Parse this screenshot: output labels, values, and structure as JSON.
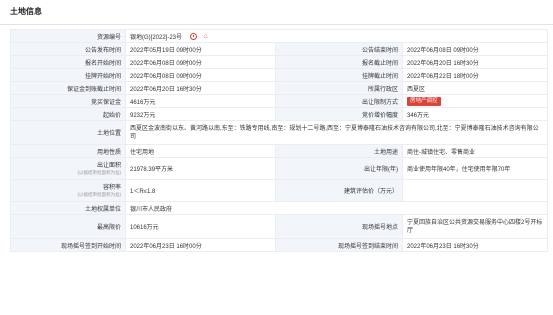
{
  "header": {
    "title": "土地信息"
  },
  "badge_color": "#d9433a",
  "rows": {
    "zybh": {
      "label": "资源编号",
      "value": "银地(G)[2022]-23号"
    },
    "ggfb": {
      "label": "公告发布时间",
      "value": "2022年05月19日 09时00分"
    },
    "ggjz": {
      "label": "公告结束时间",
      "value": "2022年06月08日 09时00分"
    },
    "bmks": {
      "label": "报名开始时间",
      "value": "2022年06月08日 09时00分"
    },
    "bmjz": {
      "label": "报名截止时间",
      "value": "2022年06月20日 16时30分"
    },
    "gpks": {
      "label": "挂牌开始时间",
      "value": "2022年06月08日 09时00分"
    },
    "gpjz": {
      "label": "挂牌截止时间",
      "value": "2022年06月22日 18时00分"
    },
    "bzj": {
      "label": "保证金到账截止时间",
      "value": "2022年06月20日 16时30分"
    },
    "xzq": {
      "label": "所属行政区",
      "value": "西夏区"
    },
    "jmbzj": {
      "label": "竞买保证金",
      "value": "4616万元"
    },
    "crxz": {
      "label": "出让限制方式",
      "value": "房地产调控"
    },
    "qsj": {
      "label": "起始价",
      "value": "9232万元"
    },
    "zjfd": {
      "label": "竞价增价幅度",
      "value": "346万元"
    },
    "tdwz": {
      "label": "土地位置",
      "value": "西夏区金波南街以东、黄河路以南,东至：铁路专用线,南至：规划十二号路,西至：宁夏博泰隆石油技术咨询有限公司,北至：宁夏博泰隆石油技术咨询有限公司"
    },
    "ydxz": {
      "label": "用地性质",
      "value": "住宅用地"
    },
    "tdyt": {
      "label": "土地用途",
      "value": "商住-城镇住宅、零售商业"
    },
    "crmj": {
      "label": "出让面积",
      "sub": "(以据结审批面积为准)",
      "value": "21978.39平方米"
    },
    "crnx": {
      "label": "出让年限(年)",
      "value": "商业使用年限40年，住宅使用年限70年"
    },
    "rjl": {
      "label": "容积率",
      "sub": "(以据结审批面积为准)",
      "value": "1＜R≤1.8"
    },
    "jzpj": {
      "label": "建筑评估价（万元）",
      "value": ""
    },
    "tdqs": {
      "label": "土地权属单位",
      "value": "银川市人民政府"
    },
    "zgbj": {
      "label": "最高限价",
      "value": "10616万元"
    },
    "xcdd": {
      "label": "现场摇号地点",
      "value": "宁夏回族自治区公共资源交易服务中心四楼2号开标厅"
    },
    "yhks": {
      "label": "现场摇号签到开始时间",
      "value": "2022年06月23日 16时00分"
    },
    "yhjs": {
      "label": "现场摇号签到结束时间",
      "value": "2022年06月23日 16时30分"
    }
  }
}
